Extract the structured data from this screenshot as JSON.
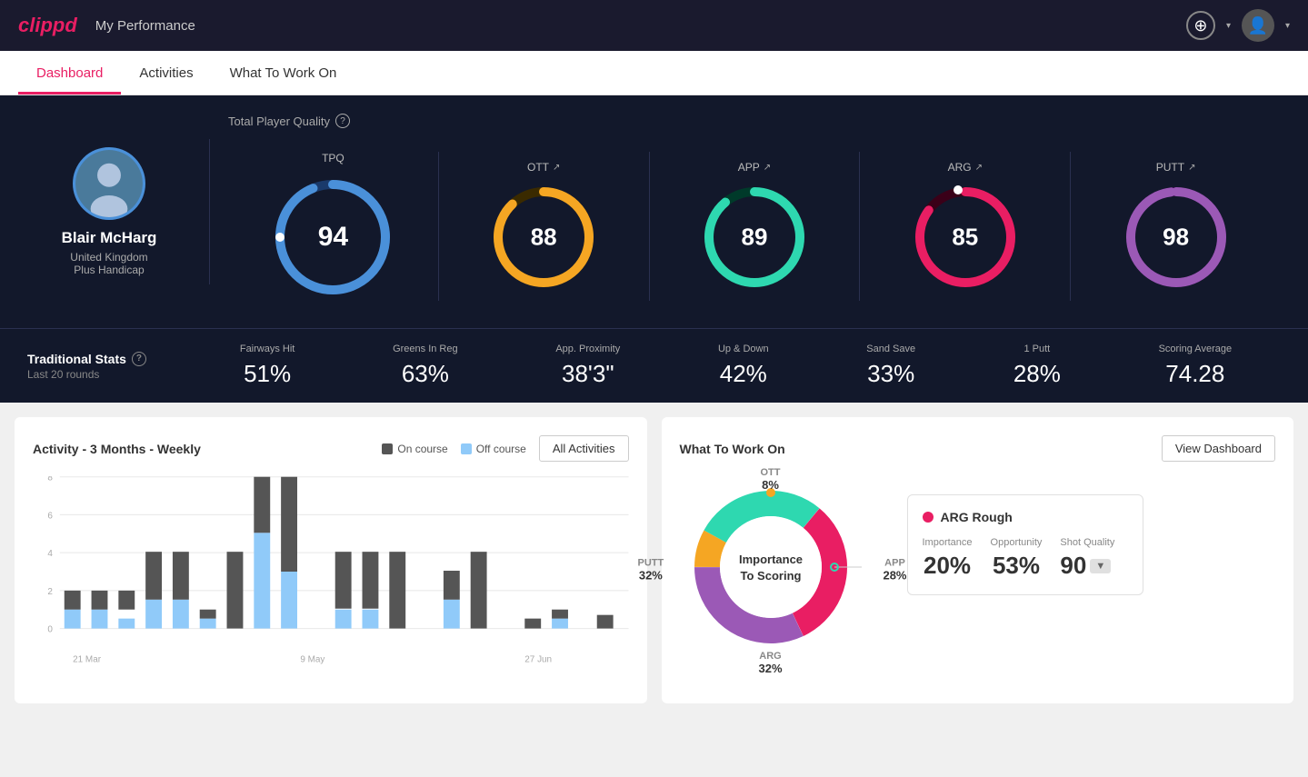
{
  "app": {
    "logo": "clippd",
    "header_title": "My Performance"
  },
  "nav": {
    "tabs": [
      {
        "label": "Dashboard",
        "active": true
      },
      {
        "label": "Activities",
        "active": false
      },
      {
        "label": "What To Work On",
        "active": false
      }
    ]
  },
  "player": {
    "name": "Blair McHarg",
    "country": "United Kingdom",
    "handicap": "Plus Handicap",
    "avatar_emoji": "🧑"
  },
  "quality": {
    "label": "Total Player Quality",
    "scores": [
      {
        "label": "TPQ",
        "value": "94",
        "color_track": "#1a3a6b",
        "color_fill": "#4a90d9",
        "percent": 94
      },
      {
        "label": "OTT",
        "value": "88",
        "color_track": "#3a2a00",
        "color_fill": "#f5a623",
        "percent": 88,
        "trend": "↗"
      },
      {
        "label": "APP",
        "value": "89",
        "color_track": "#003a2a",
        "color_fill": "#2ed8b0",
        "percent": 89,
        "trend": "↗"
      },
      {
        "label": "ARG",
        "value": "85",
        "color_track": "#3a0018",
        "color_fill": "#e91e63",
        "percent": 85,
        "trend": "↗"
      },
      {
        "label": "PUTT",
        "value": "98",
        "color_track": "#2a0040",
        "color_fill": "#9b59b6",
        "percent": 98,
        "trend": "↗"
      }
    ]
  },
  "trad_stats": {
    "label": "Traditional Stats",
    "sublabel": "Last 20 rounds",
    "items": [
      {
        "label": "Fairways Hit",
        "value": "51%"
      },
      {
        "label": "Greens In Reg",
        "value": "63%"
      },
      {
        "label": "App. Proximity",
        "value": "38'3\""
      },
      {
        "label": "Up & Down",
        "value": "42%"
      },
      {
        "label": "Sand Save",
        "value": "33%"
      },
      {
        "label": "1 Putt",
        "value": "28%"
      },
      {
        "label": "Scoring Average",
        "value": "74.28"
      }
    ]
  },
  "activity_chart": {
    "title": "Activity - 3 Months - Weekly",
    "legend": [
      {
        "label": "On course",
        "color": "#555"
      },
      {
        "label": "Off course",
        "color": "#90caf9"
      }
    ],
    "all_activities_btn": "All Activities",
    "x_labels": [
      "21 Mar",
      "9 May",
      "27 Jun"
    ],
    "y_labels": [
      "0",
      "2",
      "4",
      "6",
      "8"
    ],
    "bars": [
      {
        "on": 1,
        "off": 1
      },
      {
        "on": 1,
        "off": 1
      },
      {
        "on": 1,
        "off": 0.5
      },
      {
        "on": 2.5,
        "off": 1.5
      },
      {
        "on": 2.5,
        "off": 1.5
      },
      {
        "on": 0.5,
        "off": 0.5
      },
      {
        "on": 4,
        "off": 0
      },
      {
        "on": 3.5,
        "off": 5
      },
      {
        "on": 5,
        "off": 3
      },
      {
        "on": 0,
        "off": 0
      },
      {
        "on": 3,
        "off": 1
      },
      {
        "on": 3,
        "off": 1
      },
      {
        "on": 3,
        "off": 0
      },
      {
        "on": 0,
        "off": 0
      },
      {
        "on": 1.5,
        "off": 1.5
      },
      {
        "on": 3,
        "off": 0
      },
      {
        "on": 0,
        "off": 0
      },
      {
        "on": 0.5,
        "off": 0
      },
      {
        "on": 0.5,
        "off": 0.5
      },
      {
        "on": 0,
        "off": 0
      },
      {
        "on": 0.7,
        "off": 0
      }
    ]
  },
  "work_on": {
    "title": "What To Work On",
    "view_dashboard_btn": "View Dashboard",
    "center_label_1": "Importance",
    "center_label_2": "To Scoring",
    "segments": [
      {
        "label": "OTT",
        "percent": "8%",
        "color": "#f5a623",
        "value": 8
      },
      {
        "label": "APP",
        "percent": "28%",
        "color": "#2ed8b0",
        "value": 28
      },
      {
        "label": "ARG",
        "percent": "32%",
        "color": "#e91e63",
        "value": 32
      },
      {
        "label": "PUTT",
        "percent": "32%",
        "color": "#9b59b6",
        "value": 32
      }
    ],
    "detail": {
      "dot_color": "#e91e63",
      "title": "ARG Rough",
      "metrics": [
        {
          "label": "Importance",
          "value": "20%"
        },
        {
          "label": "Opportunity",
          "value": "53%"
        },
        {
          "label": "Shot Quality",
          "value": "90",
          "badge": "▼"
        }
      ]
    }
  }
}
